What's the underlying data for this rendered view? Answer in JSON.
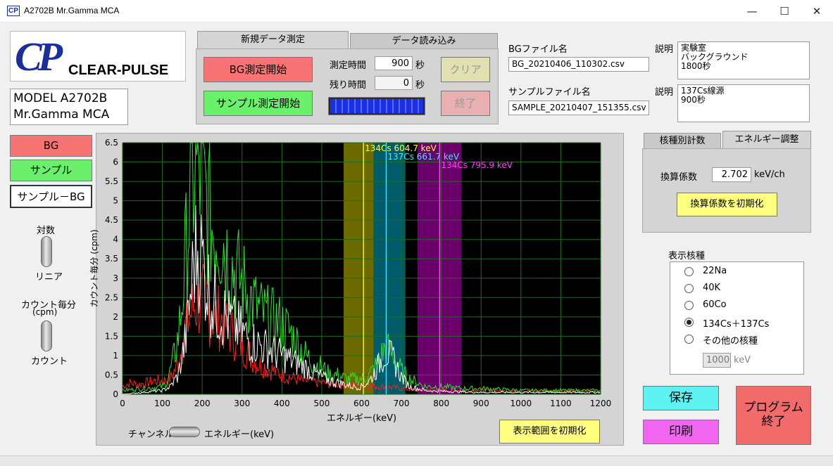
{
  "window": {
    "title": "A2702B Mr.Gamma MCA",
    "icon_text": "CP",
    "minimize": "—",
    "maximize": "☐",
    "close": "✕"
  },
  "logo": {
    "mark": "CP",
    "name": "CLEAR-PULSE"
  },
  "model": {
    "line1": "MODEL A2702B",
    "line2": "Mr.Gamma MCA"
  },
  "measure_tabs": [
    {
      "label": "新規データ測定",
      "active": true
    },
    {
      "label": "データ読み込み",
      "active": false
    }
  ],
  "measure": {
    "bg_start": "BG測定開始",
    "sample_start": "サンプル測定開始",
    "time_label": "測定時間",
    "time_value": "900",
    "time_unit": "秒",
    "remain_label": "残り時間",
    "remain_value": "0",
    "remain_unit": "秒",
    "clear": "クリア",
    "end": "終了",
    "progress": 1.0
  },
  "files": {
    "bg_label": "BGファイル名",
    "bg_value": "BG_20210406_110302.csv",
    "sample_label": "サンプルファイル名",
    "sample_value": "SAMPLE_20210407_151355.csv"
  },
  "desc": {
    "label1": "説明",
    "value1": [
      "実験室",
      "バックグラウンド",
      "1800秒"
    ],
    "label2": "説明",
    "value2": [
      "137Cs線源",
      "900秒"
    ]
  },
  "series_buttons": {
    "bg": "BG",
    "sample": "サンプル",
    "diff": "サンプル－BG"
  },
  "scale_toggle": {
    "top": "対数",
    "bottom": "リニア"
  },
  "unit_toggle": {
    "top_line1": "カウント毎分",
    "top_line2": "(cpm)",
    "bottom": "カウント"
  },
  "axis_toggle": {
    "left": "チャンネル",
    "right": "エネルギー(keV)"
  },
  "reset_range": "表示範囲を初期化",
  "right_tabs": [
    {
      "label": "核種別計数",
      "active": false
    },
    {
      "label": "エネルギー調整",
      "active": true
    }
  ],
  "energy": {
    "factor_label": "換算係数",
    "factor_value": "2.702",
    "factor_unit": "keV/ch",
    "reset": "換算係数を初期化"
  },
  "nuclides": {
    "title": "表示核種",
    "options": [
      {
        "label": "22Na",
        "selected": false
      },
      {
        "label": "40K",
        "selected": false
      },
      {
        "label": "60Co",
        "selected": false
      },
      {
        "label": "134Cs＋137Cs",
        "selected": true
      },
      {
        "label": "その他の核種",
        "selected": false
      }
    ],
    "other_value": "1000",
    "other_unit": "keV"
  },
  "actions": {
    "save": "保存",
    "print": "印刷",
    "quit_line1": "プログラム",
    "quit_line2": "終了"
  },
  "colors": {
    "bg": "#ff6b6b",
    "sample": "#66ee66",
    "diff": "#ffffff",
    "save": "#5ff2f2",
    "print": "#f066f0",
    "quit": "#f26b6b",
    "yellow": "#ffff80"
  },
  "chart_data": {
    "type": "line",
    "xlabel": "エネルギー(keV)",
    "ylabel": "カウント毎分 (cpm)",
    "xlim": [
      0,
      1200
    ],
    "ylim": [
      0,
      6.5
    ],
    "xticks": [
      0,
      100,
      200,
      300,
      400,
      500,
      600,
      700,
      800,
      900,
      1000,
      1100,
      1200
    ],
    "yticks": [
      0,
      0.5,
      1,
      1.5,
      2,
      2.5,
      3,
      3.5,
      4,
      4.5,
      5,
      5.5,
      6,
      6.5
    ],
    "grid": true,
    "regions": [
      {
        "from": 555,
        "to": 630,
        "color": "#6b6b00"
      },
      {
        "from": 630,
        "to": 710,
        "color": "#005b6b"
      },
      {
        "from": 740,
        "to": 850,
        "color": "#6b006b"
      }
    ],
    "peaks": [
      {
        "label": "134Cs 604.7 keV",
        "energy": 604.7,
        "color": "#ffff40"
      },
      {
        "label": "137Cs 661.7 keV",
        "energy": 661.7,
        "color": "#40e8ff"
      },
      {
        "label": "134Cs 795.9 keV",
        "energy": 795.9,
        "color": "#ff40ff"
      }
    ],
    "series": [
      {
        "name": "BG",
        "color": "#ff2020",
        "x": [
          0,
          20,
          40,
          60,
          80,
          100,
          120,
          140,
          160,
          180,
          200,
          220,
          240,
          260,
          280,
          300,
          320,
          340,
          360,
          380,
          400,
          450,
          500,
          550,
          600,
          650,
          700,
          750,
          800,
          900,
          1000,
          1100,
          1200
        ],
        "y": [
          0.2,
          0.3,
          0.25,
          0.3,
          0.35,
          0.35,
          0.4,
          0.8,
          1.8,
          2.3,
          2.4,
          2.1,
          2.0,
          1.8,
          1.5,
          1.3,
          1.0,
          0.8,
          0.7,
          0.6,
          0.5,
          0.35,
          0.3,
          0.25,
          0.2,
          0.2,
          0.15,
          0.1,
          0.1,
          0.1,
          0.08,
          0.08,
          0.08
        ]
      },
      {
        "name": "サンプル",
        "color": "#30e030",
        "x": [
          0,
          100,
          110,
          120,
          130,
          140,
          150,
          160,
          170,
          180,
          190,
          200,
          210,
          220,
          230,
          240,
          250,
          260,
          270,
          280,
          300,
          320,
          340,
          360,
          380,
          400,
          420,
          440,
          460,
          480,
          500,
          520,
          540,
          560,
          580,
          600,
          620,
          640,
          660,
          680,
          700,
          720,
          740,
          760,
          800,
          850,
          900,
          1000,
          1100,
          1200
        ],
        "y": [
          0.1,
          0.2,
          0.3,
          0.6,
          1.0,
          1.5,
          2.5,
          3.8,
          5.0,
          5.8,
          5.9,
          5.4,
          5.0,
          4.5,
          4.2,
          4.3,
          4.1,
          3.7,
          3.4,
          3.2,
          2.9,
          2.5,
          2.2,
          2.0,
          1.9,
          1.8,
          1.6,
          1.3,
          1.0,
          0.8,
          0.7,
          0.5,
          0.5,
          0.4,
          0.4,
          0.4,
          0.5,
          0.8,
          1.2,
          1.0,
          0.6,
          0.4,
          0.3,
          0.2,
          0.2,
          0.15,
          0.15,
          0.1,
          0.1,
          0.1
        ]
      },
      {
        "name": "サンプル－BG",
        "color": "#ffffff",
        "x": [
          0,
          100,
          120,
          140,
          160,
          170,
          180,
          190,
          200,
          210,
          220,
          240,
          260,
          280,
          300,
          320,
          340,
          360,
          380,
          400,
          420,
          440,
          460,
          480,
          500,
          520,
          540,
          560,
          580,
          600,
          620,
          640,
          660,
          680,
          700,
          720,
          760,
          800,
          900,
          1000,
          1100,
          1200
        ],
        "y": [
          0,
          0.1,
          0.2,
          0.5,
          1.5,
          2.5,
          3.5,
          3.8,
          3.5,
          3.0,
          2.6,
          2.2,
          2.0,
          1.8,
          1.6,
          1.4,
          1.3,
          1.2,
          1.1,
          1.0,
          0.9,
          0.8,
          0.7,
          0.55,
          0.45,
          0.35,
          0.3,
          0.25,
          0.2,
          0.2,
          0.35,
          0.7,
          1.1,
          0.9,
          0.45,
          0.2,
          0.1,
          0.08,
          0.05,
          0.05,
          0.05,
          0.05
        ]
      }
    ]
  }
}
